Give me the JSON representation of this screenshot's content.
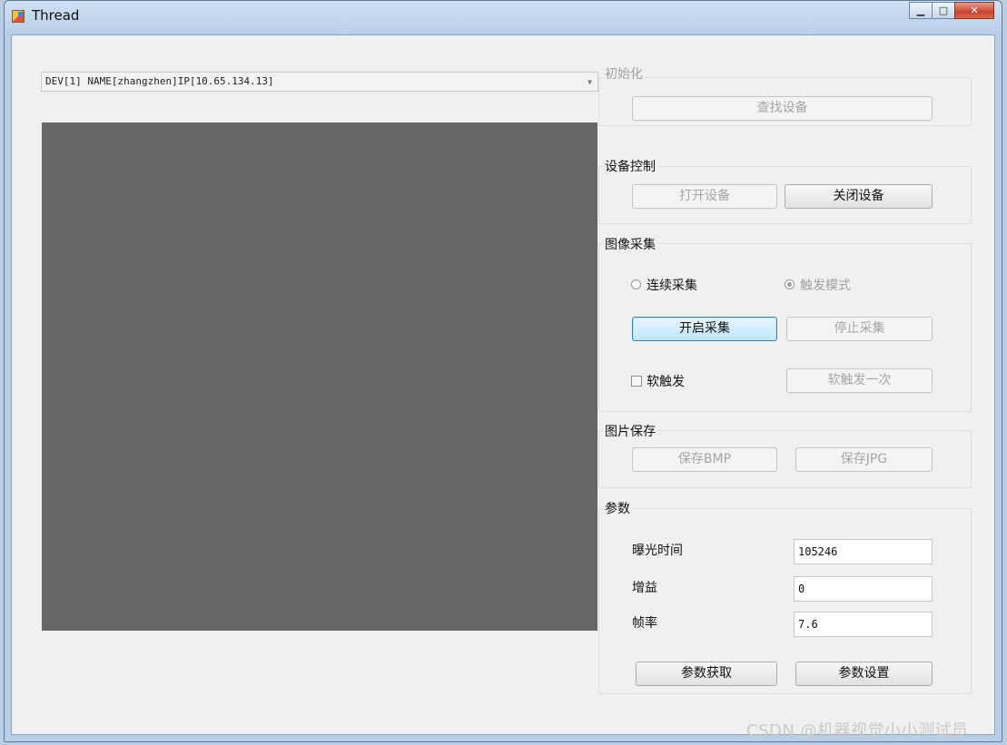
{
  "window": {
    "title": "Thread"
  },
  "device_combo": {
    "value": "DEV[1] NAME[zhangzhen]IP[10.65.134.13]"
  },
  "init_group": {
    "title": "初始化",
    "find_button": "查找设备"
  },
  "device_group": {
    "title": "设备控制",
    "open_button": "打开设备",
    "close_button": "关闭设备"
  },
  "capture_group": {
    "title": "图像采集",
    "continuous_label": "连续采集",
    "trigger_label": "触发模式",
    "start_button": "开启采集",
    "stop_button": "停止采集",
    "soft_trigger_label": "软触发",
    "soft_trigger_once_button": "软触发一次"
  },
  "save_group": {
    "title": "图片保存",
    "bmp_button": "保存BMP",
    "jpg_button": "保存JPG"
  },
  "params_group": {
    "title": "参数",
    "exposure_label": "曝光时间",
    "exposure_value": "105246",
    "gain_label": "增益",
    "gain_value": "0",
    "framerate_label": "帧率",
    "framerate_value": "7.6",
    "get_button": "参数获取",
    "set_button": "参数设置"
  },
  "watermark": "CSDN @机器视觉小小测试员"
}
